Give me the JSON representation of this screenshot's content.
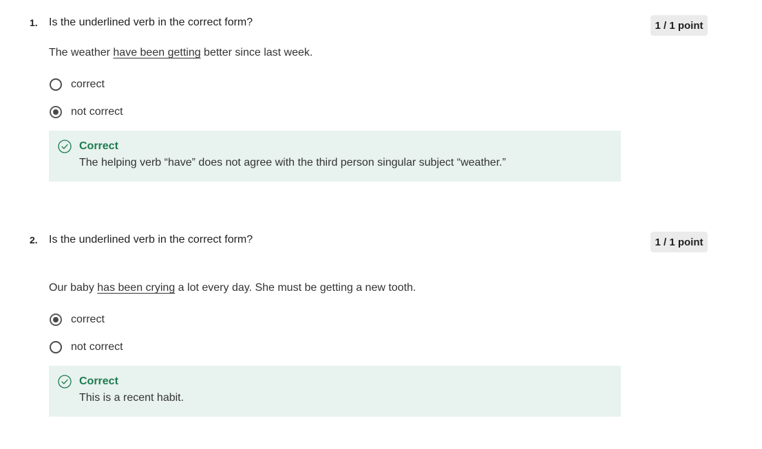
{
  "questions": [
    {
      "number": "1.",
      "prompt": "Is the underlined verb in the correct form?",
      "points": "1 / 1 point",
      "sentence": {
        "before": "The weather ",
        "underlined": "have been getting",
        "after": " better since last week."
      },
      "options": [
        {
          "label": "correct",
          "selected": false
        },
        {
          "label": "not correct",
          "selected": true
        }
      ],
      "feedback": {
        "title": "Correct",
        "text": "The helping verb “have” does not agree with the third person singular subject “weather.”",
        "icon": "check-circle-icon",
        "color": "#1d7c50"
      }
    },
    {
      "number": "2.",
      "prompt": "Is the underlined verb in the correct form?",
      "points": "1 / 1 point",
      "sentence": {
        "before": "Our baby ",
        "underlined": "has been crying",
        "after": " a lot every day. She must be getting a new tooth."
      },
      "options": [
        {
          "label": "correct",
          "selected": true
        },
        {
          "label": "not correct",
          "selected": false
        }
      ],
      "feedback": {
        "title": "Correct",
        "text": "This is a recent habit.",
        "icon": "check-circle-icon",
        "color": "#1d7c50"
      }
    }
  ],
  "colors": {
    "feedback_background": "#e8f2ee",
    "correct_green": "#1d7c50",
    "badge_background": "#ebebeb"
  }
}
